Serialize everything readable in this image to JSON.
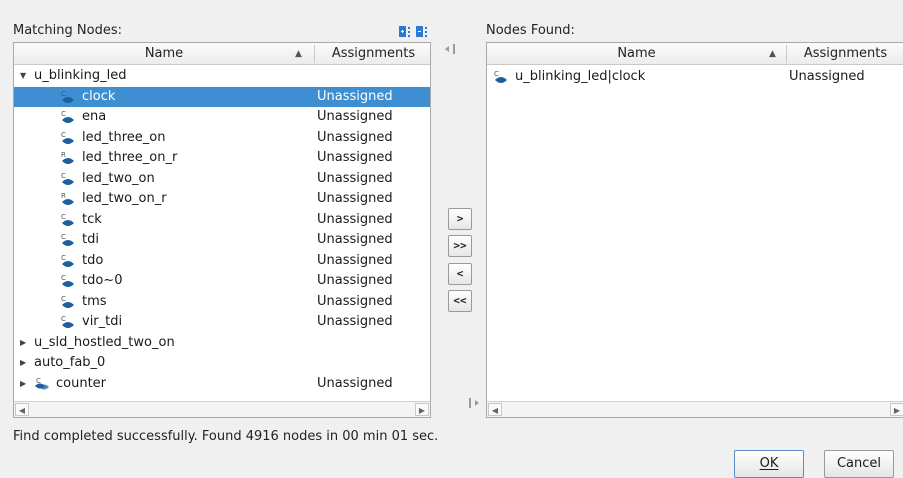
{
  "left": {
    "title": "Matching Nodes:",
    "columns": {
      "name": "Name",
      "assignments": "Assignments"
    },
    "rows": [
      {
        "label": "u_blinking_led",
        "assign": "",
        "type": "group",
        "expanded": true
      },
      {
        "label": "clock",
        "assign": "Unassigned",
        "type": "C",
        "selected": true
      },
      {
        "label": "ena",
        "assign": "Unassigned",
        "type": "C"
      },
      {
        "label": "led_three_on",
        "assign": "Unassigned",
        "type": "C"
      },
      {
        "label": "led_three_on_r",
        "assign": "Unassigned",
        "type": "R"
      },
      {
        "label": "led_two_on",
        "assign": "Unassigned",
        "type": "C"
      },
      {
        "label": "led_two_on_r",
        "assign": "Unassigned",
        "type": "R"
      },
      {
        "label": "tck",
        "assign": "Unassigned",
        "type": "C"
      },
      {
        "label": "tdi",
        "assign": "Unassigned",
        "type": "C"
      },
      {
        "label": "tdo",
        "assign": "Unassigned",
        "type": "C"
      },
      {
        "label": "tdo~0",
        "assign": "Unassigned",
        "type": "C"
      },
      {
        "label": "tms",
        "assign": "Unassigned",
        "type": "C"
      },
      {
        "label": "vir_tdi",
        "assign": "Unassigned",
        "type": "C"
      },
      {
        "label": "u_sld_hostled_two_on",
        "assign": "",
        "type": "group",
        "expanded": false
      },
      {
        "label": "auto_fab_0",
        "assign": "",
        "type": "group",
        "expanded": false
      },
      {
        "label": "counter",
        "assign": "Unassigned",
        "type": "group-icon",
        "expanded": false
      }
    ]
  },
  "right": {
    "title": "Nodes Found:",
    "columns": {
      "name": "Name",
      "assignments": "Assignments"
    },
    "rows": [
      {
        "label": "u_blinking_led|clock",
        "assign": "Unassigned",
        "type": "C"
      }
    ]
  },
  "move_buttons": {
    "add": ">",
    "add_all": ">>",
    "remove": "<",
    "remove_all": "<<"
  },
  "status": "Find completed successfully. Found 4916 nodes in 00 min 01 sec.",
  "buttons": {
    "ok": "OK",
    "cancel": "Cancel"
  },
  "colors": {
    "selection": "#3d8fd1",
    "node_icon": "#1f5f9e",
    "toolbar_icon": "#2b7bd6"
  },
  "icons": {
    "expand_all": "expand-all-icon",
    "collapse_all": "collapse-all-icon",
    "collapse_left": "collapse-left-icon",
    "collapse_right": "collapse-right-icon"
  }
}
